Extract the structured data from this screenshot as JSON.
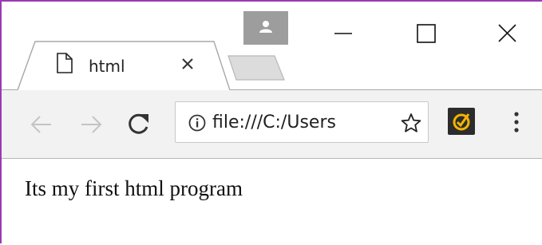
{
  "window": {
    "accent_color": "#9b3ab4"
  },
  "profile": {
    "icon": "person-icon"
  },
  "window_controls": {
    "minimize_icon": "minimize-icon",
    "maximize_icon": "maximize-icon",
    "close_icon": "close-icon"
  },
  "tabs": [
    {
      "title": "html",
      "icon": "page-icon",
      "close_icon": "close-icon",
      "active": true
    }
  ],
  "toolbar": {
    "back_icon": "arrow-left-icon",
    "forward_icon": "arrow-right-icon",
    "reload_icon": "reload-icon",
    "omnibox": {
      "security_icon": "info-icon",
      "url": "file:///C:/Users",
      "bookmark_icon": "star-icon"
    },
    "extension_icon": "checkmark-badge-icon",
    "menu_icon": "three-dots-icon"
  },
  "page": {
    "text": "Its my first html program"
  }
}
